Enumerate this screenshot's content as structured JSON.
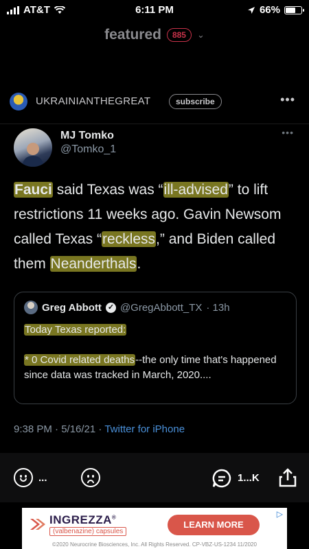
{
  "status_bar": {
    "carrier": "AT&T",
    "time": "6:11 PM",
    "battery": "66%",
    "battery_level": 0.66
  },
  "header": {
    "title": "featured",
    "badge": "885"
  },
  "post": {
    "author": "UKRAINIANTHEGREAT",
    "subscribe_label": "subscribe",
    "more": "•••"
  },
  "tweet": {
    "name": "MJ Tomko",
    "handle": "@Tomko_1",
    "more": "•••",
    "body": {
      "p1": "Fauci",
      "p2": " said Texas was “",
      "p3": "ill-advised",
      "p4": "” to lift restrictions 11 weeks ago.  Gavin Newsom called Texas “",
      "p5": "reckless",
      "p6": ",” and Biden called them ",
      "p7": "Neanderthals",
      "p8": "."
    },
    "quote": {
      "name": "Greg Abbott",
      "verified": "✓",
      "handle": "@GregAbbott_TX",
      "time": "· 13h",
      "line1": "Today Texas reported:",
      "line2_hl": "* 0 Covid related deaths",
      "line2_rest": "--the only time that's happened since data was tracked in March, 2020...."
    },
    "meta_time": "9:38 PM · 5/16/21 · ",
    "meta_source": "Twitter for iPhone"
  },
  "actions": {
    "react_more": "...",
    "comments_count": "1...K"
  },
  "ad": {
    "brand": "INGREZZA",
    "brand_mark": "®",
    "sub": "(valbenazine) capsules",
    "cta": "LEARN MORE",
    "legal": "©2020 Neurocrine Biosciences, Inc. All Rights Reserved. CP-VBZ-US-1234 11/2020",
    "adchoices": "▷"
  }
}
